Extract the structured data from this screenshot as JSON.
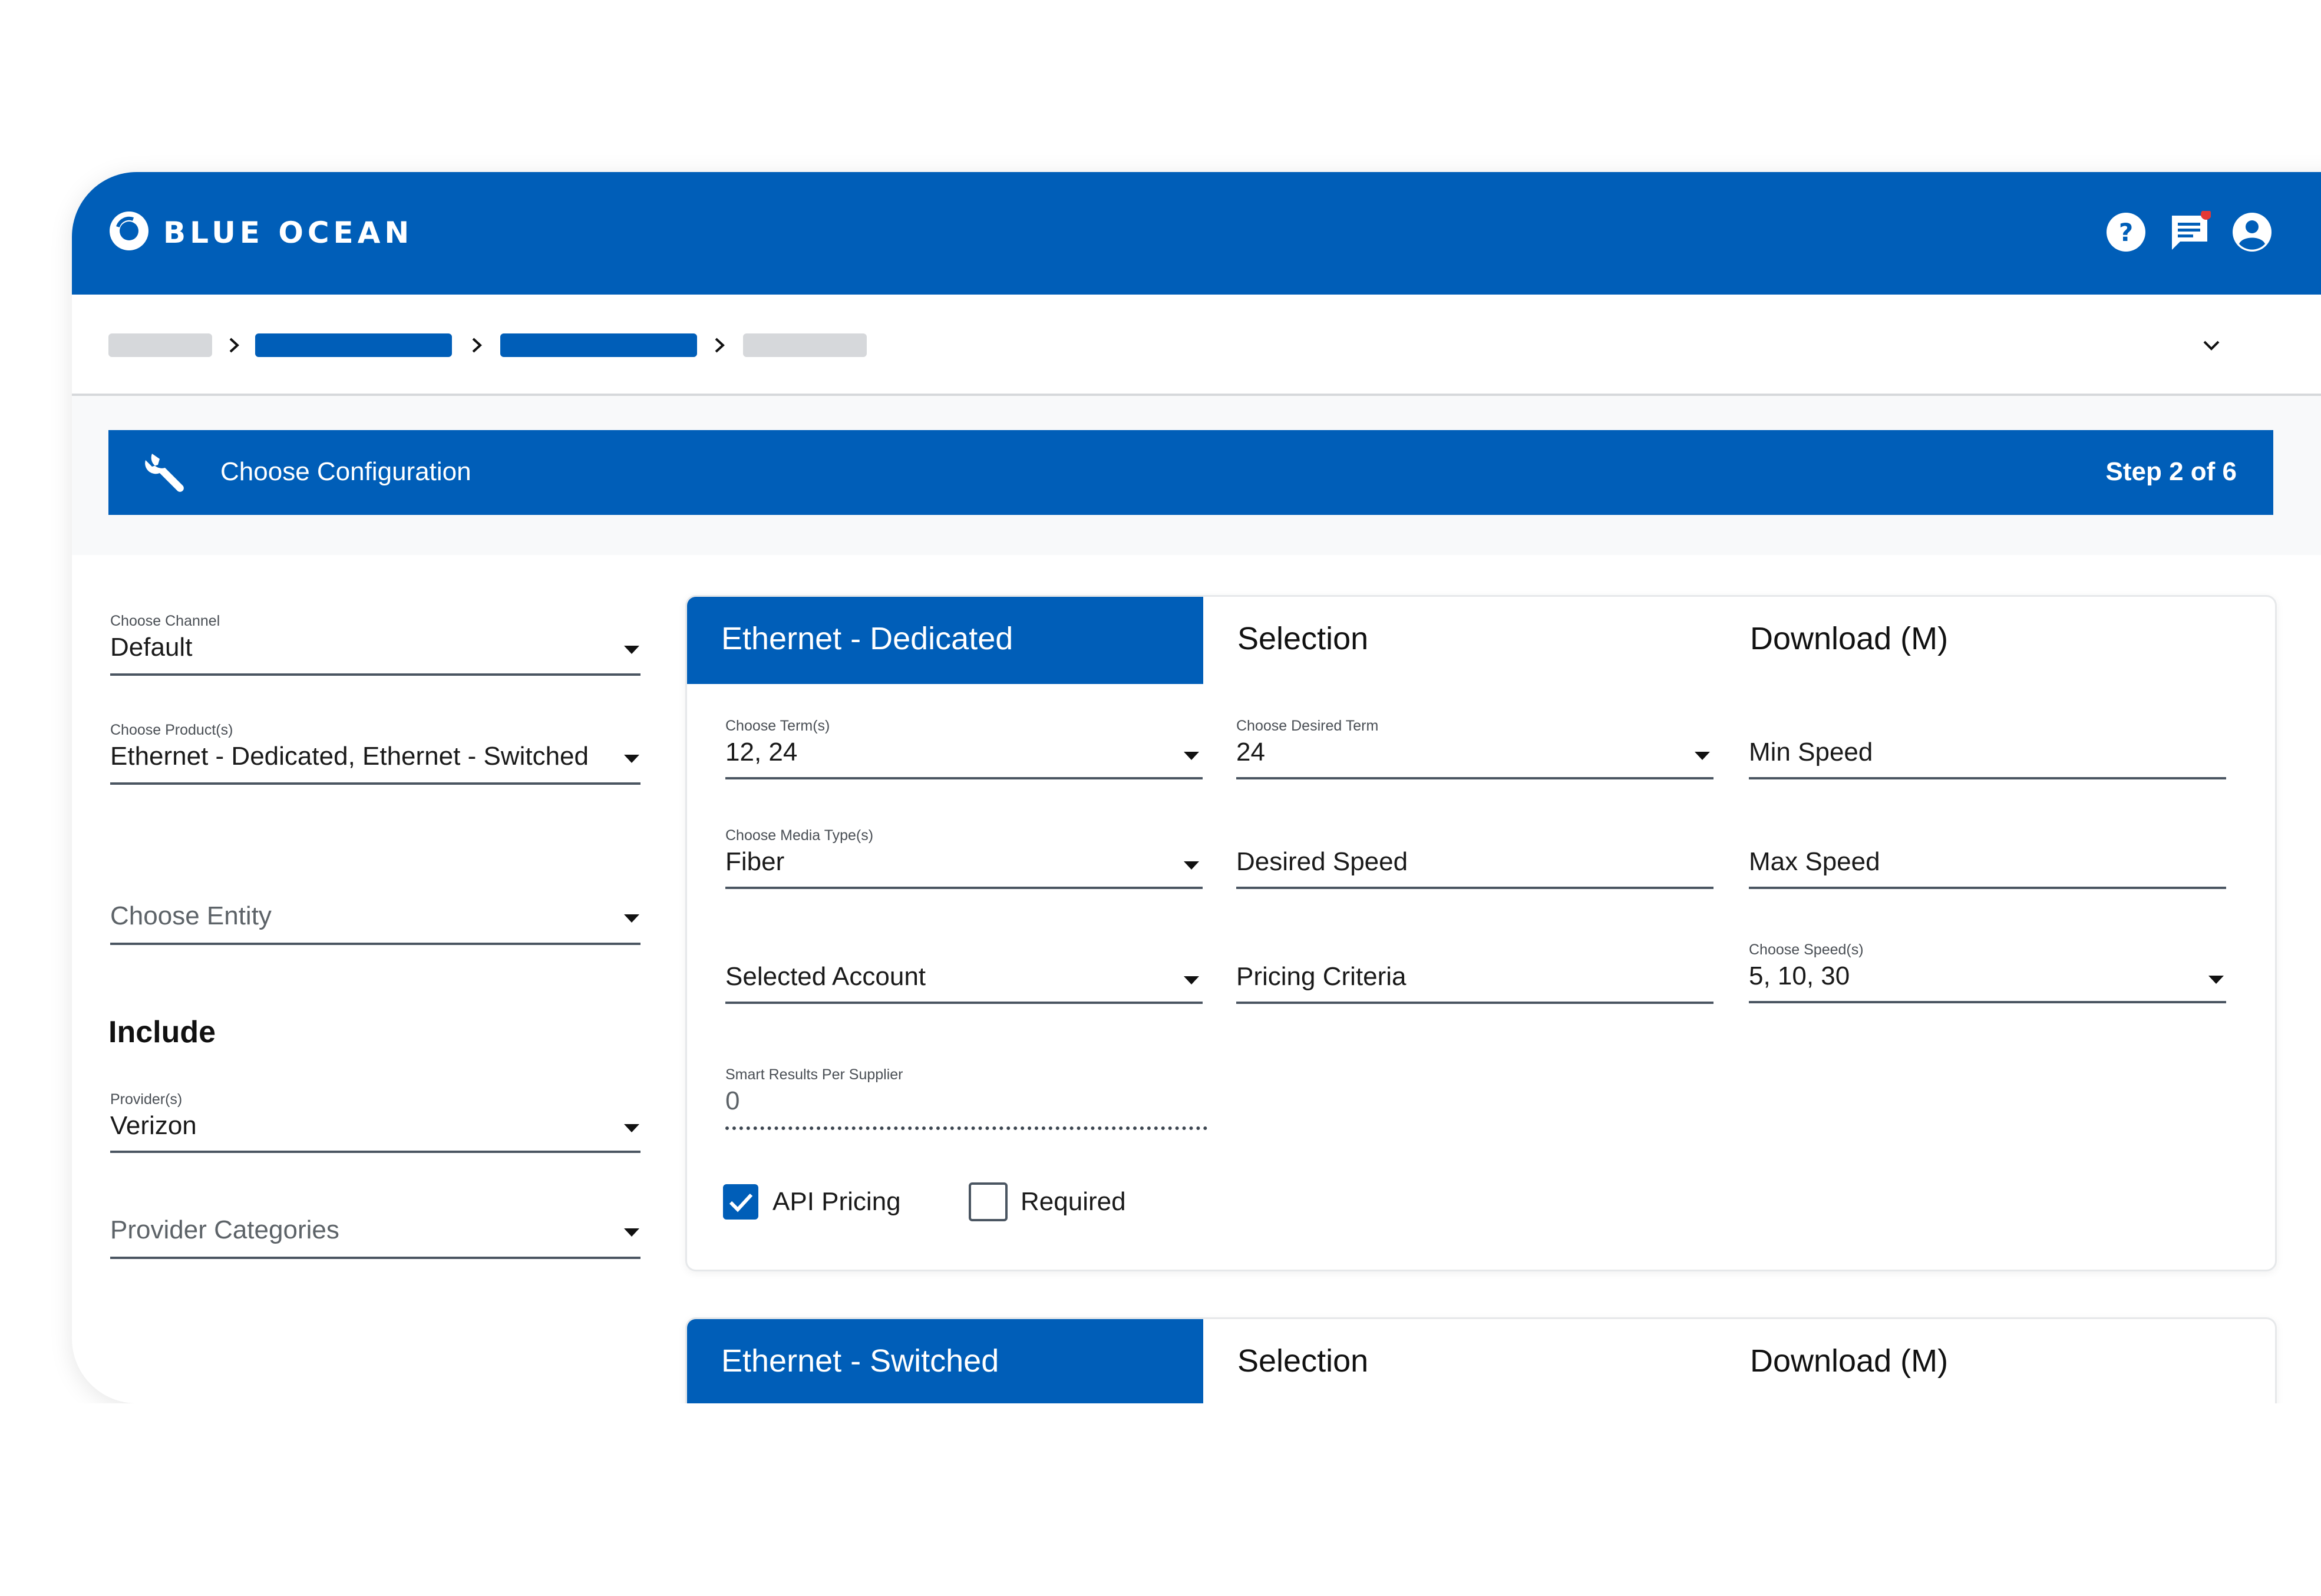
{
  "app": {
    "brand": "BLUE OCEAN",
    "accent": "#005eb8"
  },
  "topbar": {
    "icons": [
      "help-icon",
      "messages-icon",
      "account-icon"
    ],
    "notification_color": "#e53935"
  },
  "breadcrumb": {
    "expand_icon": "chevron-down-icon"
  },
  "step": {
    "title": "Choose Configuration",
    "counter": "Step 2 of 6",
    "icon": "wrench-icon"
  },
  "left": {
    "channel": {
      "label": "Choose Channel",
      "value": "Default"
    },
    "products": {
      "label": "Choose Product(s)",
      "value": "Ethernet - Dedicated, Ethernet - Switched"
    },
    "entity": {
      "placeholder": "Choose Entity"
    },
    "include_heading": "Include",
    "providers": {
      "label": "Provider(s)",
      "value": "Verizon"
    },
    "provider_categories": {
      "placeholder": "Provider Categories"
    }
  },
  "panel1": {
    "tab": "Ethernet - Dedicated",
    "col2": "Selection",
    "col3": "Download (M)",
    "terms": {
      "label": "Choose Term(s)",
      "value": "12, 24"
    },
    "desired_term": {
      "label": "Choose Desired Term",
      "value": "24"
    },
    "min_speed": {
      "placeholder": "Min Speed"
    },
    "media": {
      "label": "Choose Media Type(s)",
      "value": "Fiber"
    },
    "desired_speed": {
      "placeholder": "Desired Speed"
    },
    "max_speed": {
      "placeholder": "Max Speed"
    },
    "account": {
      "placeholder": "Selected Account"
    },
    "pricing_criteria": {
      "placeholder": "Pricing Criteria"
    },
    "speeds": {
      "label": "Choose Speed(s)",
      "value": "5, 10, 30"
    },
    "smart_results": {
      "label": "Smart Results Per Supplier",
      "value": "0"
    },
    "api_pricing": {
      "label": "API Pricing",
      "checked": true
    },
    "required": {
      "label": "Required",
      "checked": false
    }
  },
  "panel2": {
    "tab": "Ethernet - Switched",
    "col2": "Selection",
    "col3": "Download (M)"
  }
}
